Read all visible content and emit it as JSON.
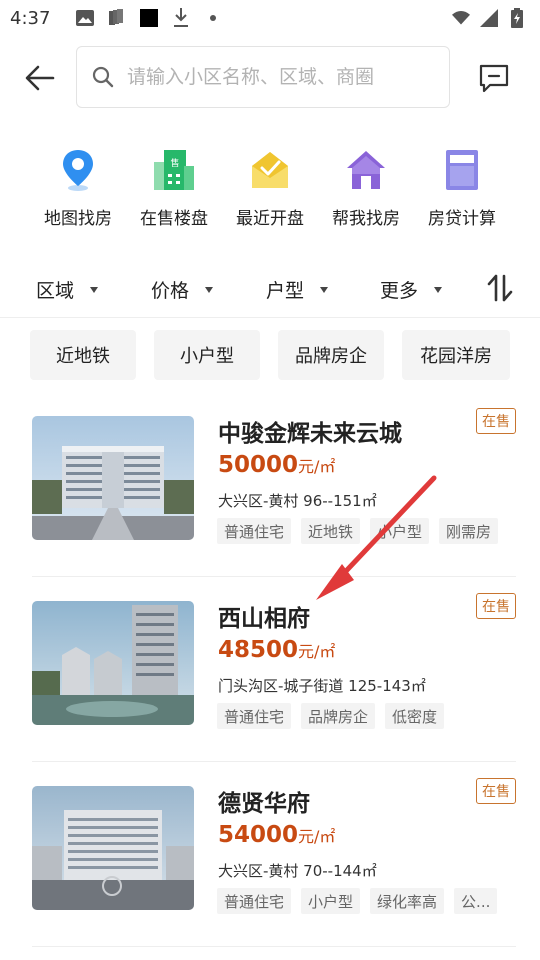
{
  "status_bar": {
    "time": "4:37",
    "icons": [
      "image-icon",
      "sim-icon",
      "black-square-icon",
      "download-icon",
      "dot-icon",
      "wifi-icon",
      "signal-icon",
      "battery-charging-icon"
    ]
  },
  "header": {
    "back_icon": "back-arrow-icon",
    "search_placeholder": "请输入小区名称、区域、商圈",
    "message_icon": "message-icon"
  },
  "quick_nav": [
    {
      "label": "地图找房",
      "icon": "map-pin-icon",
      "color": "#2f8ff0"
    },
    {
      "label": "在售楼盘",
      "icon": "building-sale-icon",
      "color": "#27b86a"
    },
    {
      "label": "最近开盘",
      "icon": "new-opening-icon",
      "color": "#f0c530"
    },
    {
      "label": "帮我找房",
      "icon": "house-help-icon",
      "color": "#8a63d8"
    },
    {
      "label": "房贷计算",
      "icon": "calculator-icon",
      "color": "#8a86e6"
    }
  ],
  "filters": [
    {
      "label": "区域"
    },
    {
      "label": "价格"
    },
    {
      "label": "户型"
    },
    {
      "label": "更多"
    }
  ],
  "sort_icon": "sort-icon",
  "chips": [
    "近地铁",
    "小户型",
    "品牌房企",
    "花园洋房"
  ],
  "accent_price_color": "#c84a12",
  "badge_color": "#c8742e",
  "listings": [
    {
      "name": "中骏金辉未来云城",
      "badge": "在售",
      "price": "50000",
      "unit": "元/㎡",
      "location": "大兴区-黄村   96--151㎡",
      "tags": [
        "普通住宅",
        "近地铁",
        "小户型",
        "刚需房"
      ]
    },
    {
      "name": "西山相府",
      "badge": "在售",
      "price": "48500",
      "unit": "元/㎡",
      "location": "门头沟区-城子街道   125-143㎡",
      "tags": [
        "普通住宅",
        "品牌房企",
        "低密度"
      ]
    },
    {
      "name": "德贤华府",
      "badge": "在售",
      "price": "54000",
      "unit": "元/㎡",
      "location": "大兴区-黄村   70--144㎡",
      "tags": [
        "普通住宅",
        "小户型",
        "绿化率高",
        "公..."
      ]
    }
  ]
}
